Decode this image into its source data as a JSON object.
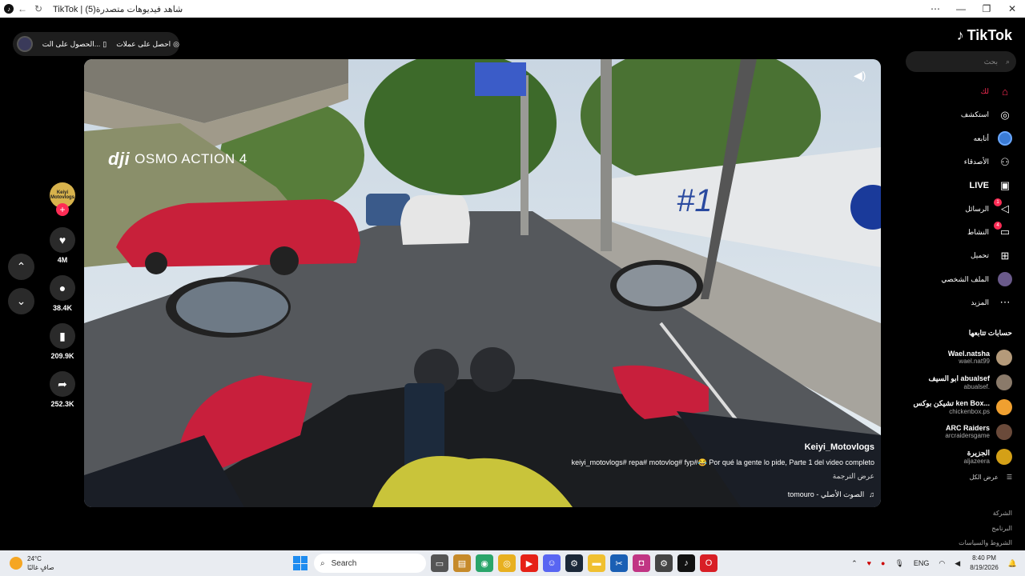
{
  "window": {
    "title": "TikTok | شاهد فيديوهات متصدرة(5)"
  },
  "top_pill": {
    "coins_label": "احصل على عملات",
    "app_label": "الحصول على الت..."
  },
  "video": {
    "brand_logo": "dji",
    "brand_text": "OSMO ACTION 4",
    "username": "Keiyi_Motovlogs",
    "description": "keiyi_motovlogs# repa# motovlog# fyp#😂 Por qué la gente lo pide, Parte 1 del video completo",
    "translate": "عرض الترجمة",
    "music": "tomouro - الصوت الأصلي"
  },
  "actions": {
    "avatar_text": "Keiyi Motovlogs",
    "likes": "4M",
    "comments": "38.4K",
    "saves": "209.9K",
    "shares": "252.3K"
  },
  "sidebar": {
    "logo": "TikTok",
    "search_placeholder": "بحث",
    "nav": [
      {
        "label": "لك",
        "icon": "home-icon"
      },
      {
        "label": "استكشف",
        "icon": "compass-icon"
      },
      {
        "label": "أتابعه",
        "icon": "following-avatar-icon"
      },
      {
        "label": "الأصدقاء",
        "icon": "friends-icon"
      },
      {
        "label": "LIVE",
        "icon": "live-icon"
      },
      {
        "label": "الرسائل",
        "icon": "messages-icon",
        "badge": "1"
      },
      {
        "label": "النشاط",
        "icon": "activity-icon",
        "badge": "4"
      },
      {
        "label": "تحميل",
        "icon": "upload-icon"
      },
      {
        "label": "الملف الشخصي",
        "icon": "profile-icon"
      },
      {
        "label": "المزيد",
        "icon": "more-icon"
      }
    ],
    "following_title": "حسابات تتابعها",
    "following": [
      {
        "name": "Wael.natsha",
        "handle": "wael.nat99",
        "color": "#b49a7a"
      },
      {
        "name": "ابو السيف abualsef",
        "handle": "abualsef.",
        "color": "#8a7a6a"
      },
      {
        "name": "تشيكن بوكس ken Box...",
        "handle": "chickenbox.ps",
        "color": "#f0a030"
      },
      {
        "name": "ARC Raiders",
        "handle": "arcraidersgame",
        "color": "#6a4a3a"
      },
      {
        "name": "الجزيرة",
        "handle": "aljazeera",
        "color": "#d4a017"
      }
    ],
    "see_all": "عرض الكل",
    "footer": [
      "الشركة",
      "البرنامج",
      "الشروط والسياسات"
    ]
  },
  "taskbar": {
    "temp": "24°C",
    "weather": "صافٍ غالبًا",
    "search": "Search",
    "lang": "ENG",
    "time": "8:40 PM",
    "date": "8/19/2026"
  }
}
